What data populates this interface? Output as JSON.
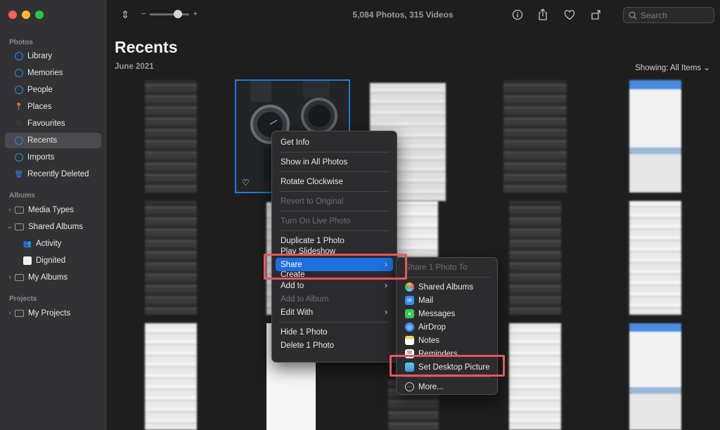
{
  "sidebar": {
    "sections": {
      "photos": "Photos",
      "albums": "Albums",
      "projects": "Projects"
    },
    "items": [
      {
        "label": "Library",
        "icon": "photos-icon"
      },
      {
        "label": "Memories",
        "icon": "memories-icon"
      },
      {
        "label": "People",
        "icon": "people-icon"
      },
      {
        "label": "Places",
        "icon": "pin-icon"
      },
      {
        "label": "Favourites",
        "icon": "heart-icon"
      },
      {
        "label": "Recents",
        "icon": "clock-icon"
      },
      {
        "label": "Imports",
        "icon": "import-icon"
      },
      {
        "label": "Recently Deleted",
        "icon": "trash-icon"
      }
    ],
    "albums": [
      {
        "label": "Media Types"
      },
      {
        "label": "Shared Albums"
      },
      {
        "label": "Activity"
      },
      {
        "label": "Dignited"
      },
      {
        "label": "My Albums"
      }
    ],
    "projects": [
      {
        "label": "My Projects"
      }
    ]
  },
  "toolbar": {
    "zoom_minus": "−",
    "zoom_plus": "+",
    "zoom_level": 0.7,
    "counts": "5,084 Photos, 315 Videos",
    "search_placeholder": "Search"
  },
  "main": {
    "title": "Recents",
    "month": "June 2021",
    "showing": "Showing: All Items"
  },
  "context_menu": {
    "items": [
      {
        "label": "Get Info"
      },
      {
        "label": "Show in All Photos"
      },
      {
        "label": "Rotate Clockwise"
      },
      {
        "label": "Revert to Original"
      },
      {
        "label": "Turn On Live Photo"
      },
      {
        "label": "Duplicate 1 Photo"
      },
      {
        "label": "Play Slideshow"
      },
      {
        "label": "Share"
      },
      {
        "label": "Create"
      },
      {
        "label": "Add to"
      },
      {
        "label": "Add to Album"
      },
      {
        "label": "Edit With"
      },
      {
        "label": "Hide 1 Photo"
      },
      {
        "label": "Delete 1 Photo"
      }
    ]
  },
  "share_submenu": {
    "header": "Share 1 Photo To",
    "items": [
      {
        "label": "Shared Albums",
        "color": "#f3b52b"
      },
      {
        "label": "Mail",
        "color": "#2f8df5"
      },
      {
        "label": "Messages",
        "color": "#34c759"
      },
      {
        "label": "AirDrop",
        "color": "#3b8ff5"
      },
      {
        "label": "Notes",
        "color": "#f6d35a"
      },
      {
        "label": "Reminders",
        "color": "#e9e9e9"
      },
      {
        "label": "Set Desktop Picture",
        "color": "#5ac8fa"
      },
      {
        "label": "More..."
      }
    ]
  },
  "colors": {
    "accent": "#1f6fe0",
    "highlight_box": "#e8565a"
  }
}
